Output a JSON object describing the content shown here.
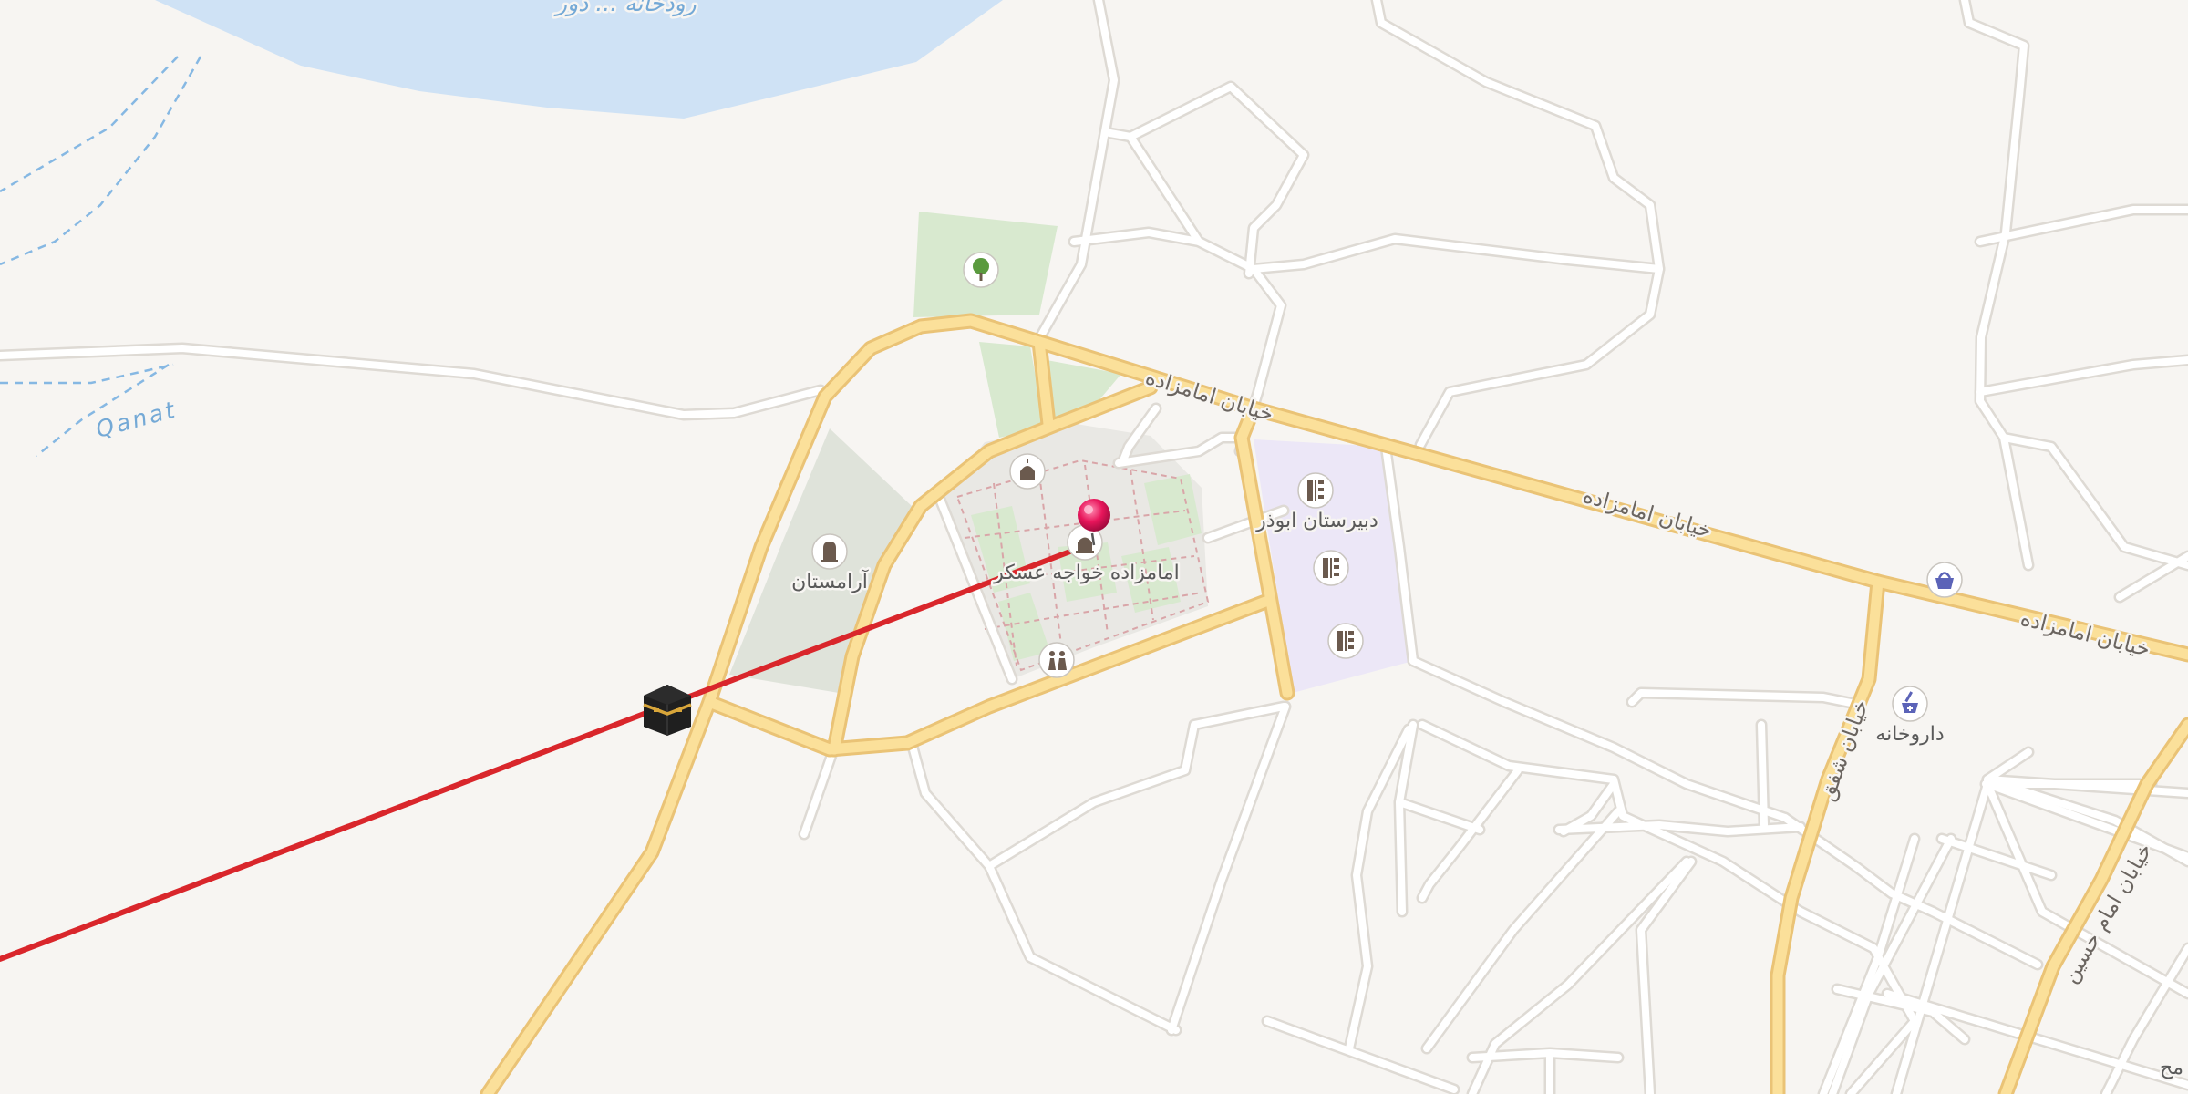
{
  "map": {
    "colors": {
      "background": "#f7f5f2",
      "water": "#cfe2f5",
      "park": "#d8e9cf",
      "cemetery": "#dfe3da",
      "school_area": "#ece7f7",
      "major_road": "#fbe09a",
      "major_road_casing": "#eac376",
      "minor_road": "#ffffff",
      "minor_road_casing": "#dedad4",
      "qibla_line": "#d9262b",
      "pin": "#e8155b"
    },
    "labels": {
      "water_body": "رودخانه ... دور",
      "qanat": "Qanat",
      "road_1": "خیابان امامزاده",
      "road_2": "خیابان امامزاده",
      "road_3": "خیابان امامزاده",
      "road_4": "خیابان شفق",
      "road_5": "خیابان امام حسین",
      "cemetery": "آرامستان",
      "shrine": "امامزاده خواجه عسکر",
      "school": "دبیرستان ابوذر",
      "pharmacy": "داروخانه",
      "edge_label": "مح"
    },
    "pois": [
      {
        "name": "tree",
        "icon": "tree-icon"
      },
      {
        "name": "cemetery",
        "icon": "cemetery-icon"
      },
      {
        "name": "mosque",
        "icon": "mosque-icon"
      },
      {
        "name": "shrine",
        "icon": "shrine-icon"
      },
      {
        "name": "toilets",
        "icon": "toilets-icon"
      },
      {
        "name": "school",
        "icon": "school-icon"
      },
      {
        "name": "shop",
        "icon": "shopping-basket-icon"
      },
      {
        "name": "pharmacy",
        "icon": "pharmacy-icon"
      },
      {
        "name": "kaaba",
        "icon": "kaaba-icon"
      },
      {
        "name": "location-pin",
        "icon": "location-pin-icon"
      }
    ]
  }
}
